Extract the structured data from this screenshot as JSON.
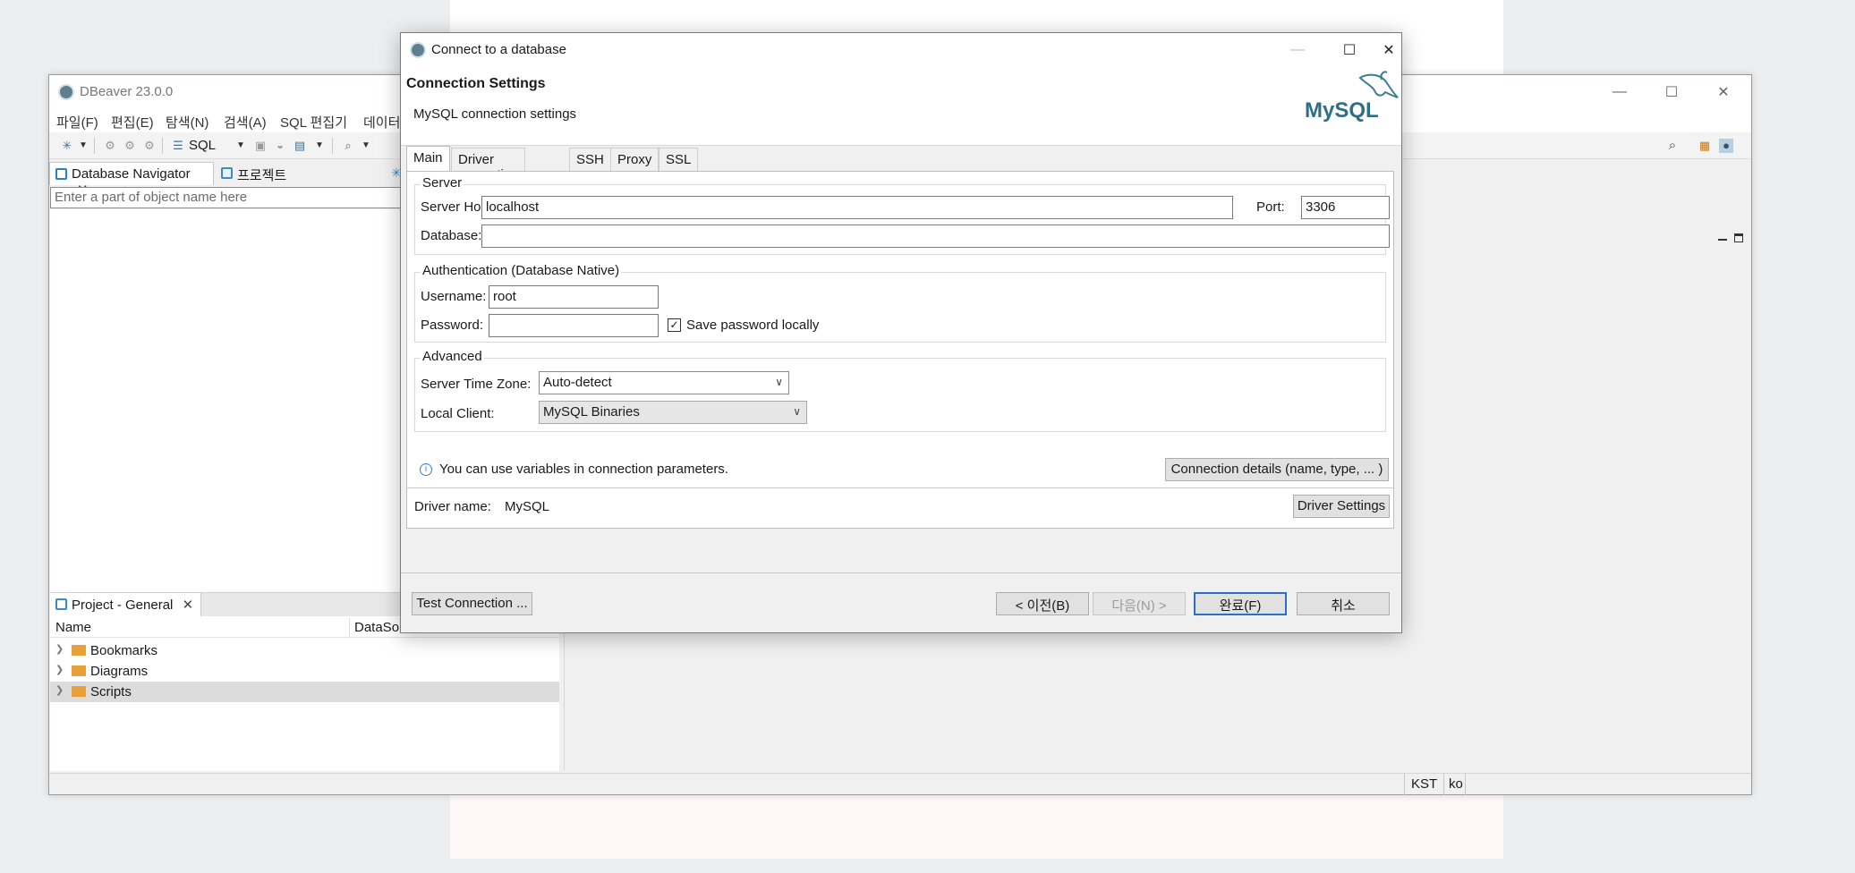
{
  "main_window": {
    "title": "DBeaver 23.0.0",
    "menu": [
      "파일(F)",
      "편집(E)",
      "탐색(N)",
      "검색(A)",
      "SQL 편집기",
      "데이터"
    ],
    "toolbar": {
      "sql_label": "SQL"
    },
    "nav_tabs": [
      "Database Navigator",
      "프로젝트"
    ],
    "filter_placeholder": "Enter a part of object name here",
    "project": {
      "tab": "Project - General",
      "columns": [
        "Name",
        "DataSou"
      ],
      "items": [
        "Bookmarks",
        "Diagrams",
        "Scripts"
      ]
    },
    "status": {
      "timezone": "KST",
      "locale": "ko"
    }
  },
  "dialog": {
    "title": "Connect to a database",
    "header_title": "Connection Settings",
    "header_subtitle": "MySQL connection settings",
    "logo_text": "MySQL",
    "tabs": [
      "Main",
      "Driver properties",
      "SSH",
      "Proxy",
      "SSL"
    ],
    "server": {
      "group": "Server",
      "host_label": "Server Host:",
      "host_value": "localhost",
      "port_label": "Port:",
      "port_value": "3306",
      "database_label": "Database:",
      "database_value": ""
    },
    "auth": {
      "group": "Authentication (Database Native)",
      "username_label": "Username:",
      "username_value": "root",
      "password_label": "Password:",
      "password_value": "",
      "save_password_label": "Save password locally",
      "save_password_checked": "✓"
    },
    "advanced": {
      "group": "Advanced",
      "timezone_label": "Server Time Zone:",
      "timezone_value": "Auto-detect",
      "client_label": "Local Client:",
      "client_value": "MySQL Binaries"
    },
    "info_text": "You can use variables in connection parameters.",
    "connection_details_button": "Connection details (name, type, ... )",
    "driver_name_label": "Driver name:",
    "driver_name_value": "MySQL",
    "driver_settings_button": "Driver Settings",
    "footer": {
      "test_connection": "Test Connection ...",
      "back": "< 이전(B)",
      "next": "다음(N) >",
      "finish": "완료(F)",
      "cancel": "취소"
    }
  }
}
